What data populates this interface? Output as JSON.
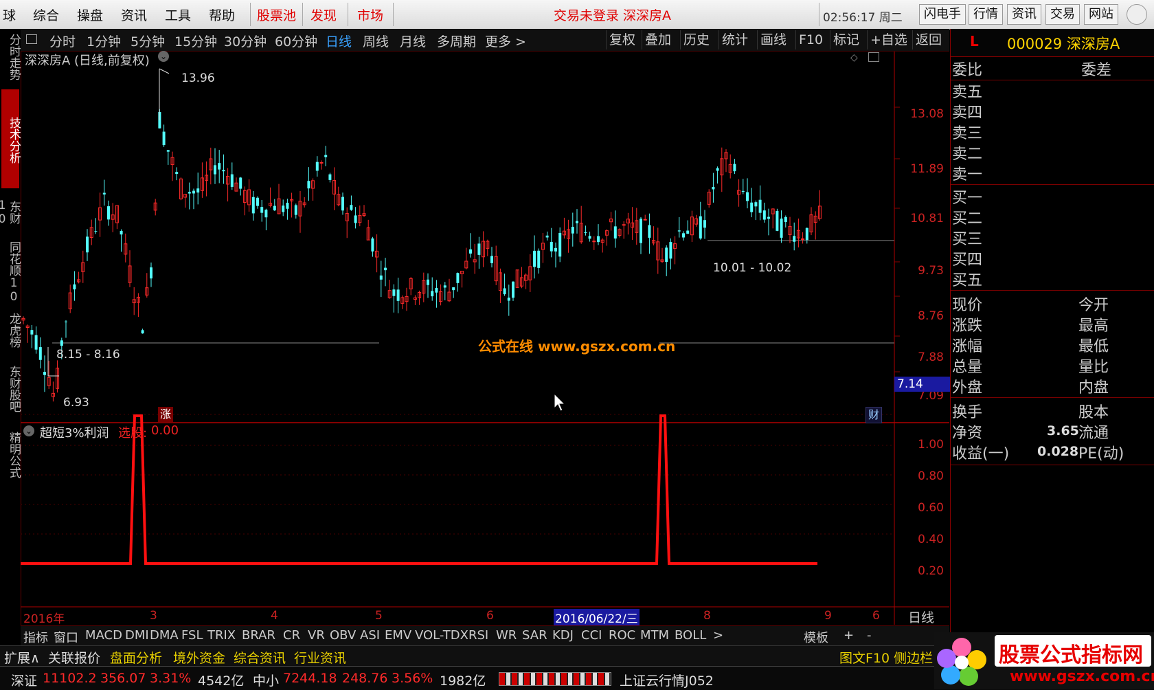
{
  "topmenu": {
    "items": [
      "球",
      "综合",
      "操盘",
      "资讯",
      "工具",
      "帮助"
    ],
    "red_items": [
      "股票池",
      "发现",
      "市场"
    ],
    "notice": "交易未登录  深深房A",
    "clock": "02:56:17 周二",
    "right_buttons": [
      "闪电手",
      "行情",
      "资讯",
      "交易",
      "网站"
    ]
  },
  "lefttabs": [
    "分时走势",
    "技术分析",
    "东财10",
    "同花顺10",
    "龙虎榜",
    "东财股吧",
    "精明公式"
  ],
  "periods": [
    "分时",
    "1分钟",
    "5分钟",
    "15分钟",
    "30分钟",
    "60分钟",
    "日线",
    "周线",
    "月线",
    "多周期",
    "更多 >"
  ],
  "toolbar": [
    "复权",
    "叠加",
    "历史",
    "统计",
    "画线",
    "F10",
    "标记",
    "+自选",
    "返回"
  ],
  "chart_title": "深深房A (日线,前复权)",
  "annotations": {
    "high": "13.96",
    "low": "6.93",
    "range1": "8.15 - 8.16",
    "range2": "10.01 - 10.02",
    "watermark": "公式在线  www.gszx.com.cn",
    "badge_zhang": "涨",
    "badge_cai": "财",
    "price_tag": "7.14"
  },
  "price_axis": [
    "13.08",
    "11.89",
    "10.81",
    "9.73",
    "8.76",
    "7.88",
    "7.09"
  ],
  "indicator": {
    "title": "超短3%利润",
    "select_label": "选股:",
    "select_value": "0.00",
    "axis": [
      "1.00",
      "0.80",
      "0.60",
      "0.40",
      "0.20"
    ]
  },
  "date_axis": {
    "labels": [
      "2016年",
      "3",
      "4",
      "5",
      "6",
      "8",
      "9",
      "6"
    ],
    "highlight": "2016/06/22/三",
    "period": "日线"
  },
  "indicator_tabs": [
    "指标",
    "窗口",
    "MACD",
    "DMI",
    "DMA",
    "FSL",
    "TRIX",
    "BRAR",
    "CR",
    "VR",
    "OBV",
    "ASI",
    "EMV",
    "VOL-TDX",
    "RSI",
    "WR",
    "SAR",
    "KDJ",
    "CCI",
    "ROC",
    "MTM",
    "BOLL",
    ">",
    "模板",
    "+",
    "-"
  ],
  "ext_tabs": [
    "扩展∧",
    "关联报价",
    "盘面分析",
    "境外资金",
    "综合资讯",
    "行业资讯"
  ],
  "ext_right": "图文F10 侧边栏",
  "quote": {
    "code_name": "000029 深深房A",
    "flag": "L",
    "weibi": "委比",
    "weicha": "委差",
    "sell": [
      "卖五",
      "卖四",
      "卖三",
      "卖二",
      "卖一"
    ],
    "buy": [
      "买一",
      "买二",
      "买三",
      "买四",
      "买五"
    ],
    "left": [
      "现价",
      "涨跌",
      "涨幅",
      "总量",
      "外盘"
    ],
    "right": [
      "今开",
      "最高",
      "最低",
      "量比",
      "内盘"
    ],
    "left2": [
      "换手",
      "净资",
      "收益(一)"
    ],
    "right2": [
      "股本",
      "流通",
      "PE(动)"
    ],
    "jingzi": "3.65",
    "shouyi": "0.028"
  },
  "status": {
    "index1_name": "深证",
    "index1_val": "11102.2",
    "index1_chg": "356.07",
    "index1_pct": "3.31%",
    "index1_amt": "4542亿",
    "index2_name": "中小",
    "index2_val": "7244.18",
    "index2_chg": "248.76",
    "index2_pct": "3.56%",
    "index2_amt": "1982亿",
    "cloud": "上证云行情J052"
  },
  "logo_text": "股票公式指标网",
  "logo_url": "www.gszx.com.cn",
  "colors": {
    "up": "#ff2a2a",
    "down": "#54ffff",
    "accent": "#39a2ff",
    "axis": "#c22222"
  }
}
